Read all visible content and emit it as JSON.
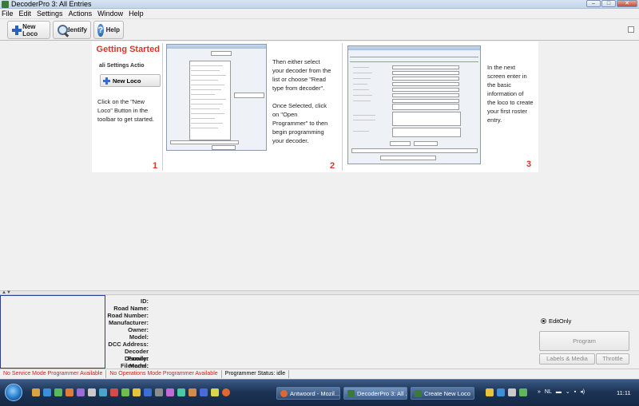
{
  "window": {
    "title": "DecoderPro 3: All Entries"
  },
  "menu": [
    "File",
    "Edit",
    "Settings",
    "Actions",
    "Window",
    "Help"
  ],
  "toolbar": {
    "new_loco": "New Loco",
    "identify": "Identify",
    "help": "Help"
  },
  "getting_started": {
    "title": "Getting Started",
    "mini_menu": "ali  Settings  Actio",
    "mini_button": "New Loco",
    "step1_text": [
      "Click on the \"New",
      "Loco\" Button in the",
      "toolbar to get started."
    ],
    "step2_text": [
      "Then either select",
      "your decoder from the",
      "list or choose \"Read",
      "type from decoder\".",
      "",
      "Once Selected, click",
      "on \"Open",
      "Programmer\" to then",
      "begin programming",
      "your decoder."
    ],
    "step3_text": [
      "In the next",
      "screen enter in",
      "the basic",
      "information of",
      "the loco to create",
      "your first roster",
      "entry."
    ],
    "step_numbers": [
      "1",
      "2",
      "3"
    ]
  },
  "roster_fields": [
    "ID:",
    "Road Name:",
    "Road Number:",
    "Manufacturer:",
    "Owner:",
    "Model:",
    "DCC Address:",
    "Decoder Family:",
    "Decoder Model:",
    "Filename:"
  ],
  "mode": {
    "edit_only": "EditOnly"
  },
  "buttons": {
    "program": "Program",
    "labels_media": "Labels & Media",
    "throttle": "Throttle"
  },
  "status": {
    "service": "No Service Mode Programmer Available",
    "ops": "No Operations Mode Programmer Available",
    "programmer": "Programmer Status:  idle"
  },
  "taskbar": {
    "tasks": [
      "Antwoord - Mozil...",
      "DecoderPro 3: All ...",
      "Create New Loco"
    ],
    "lang": "NL",
    "time": "11:11"
  }
}
